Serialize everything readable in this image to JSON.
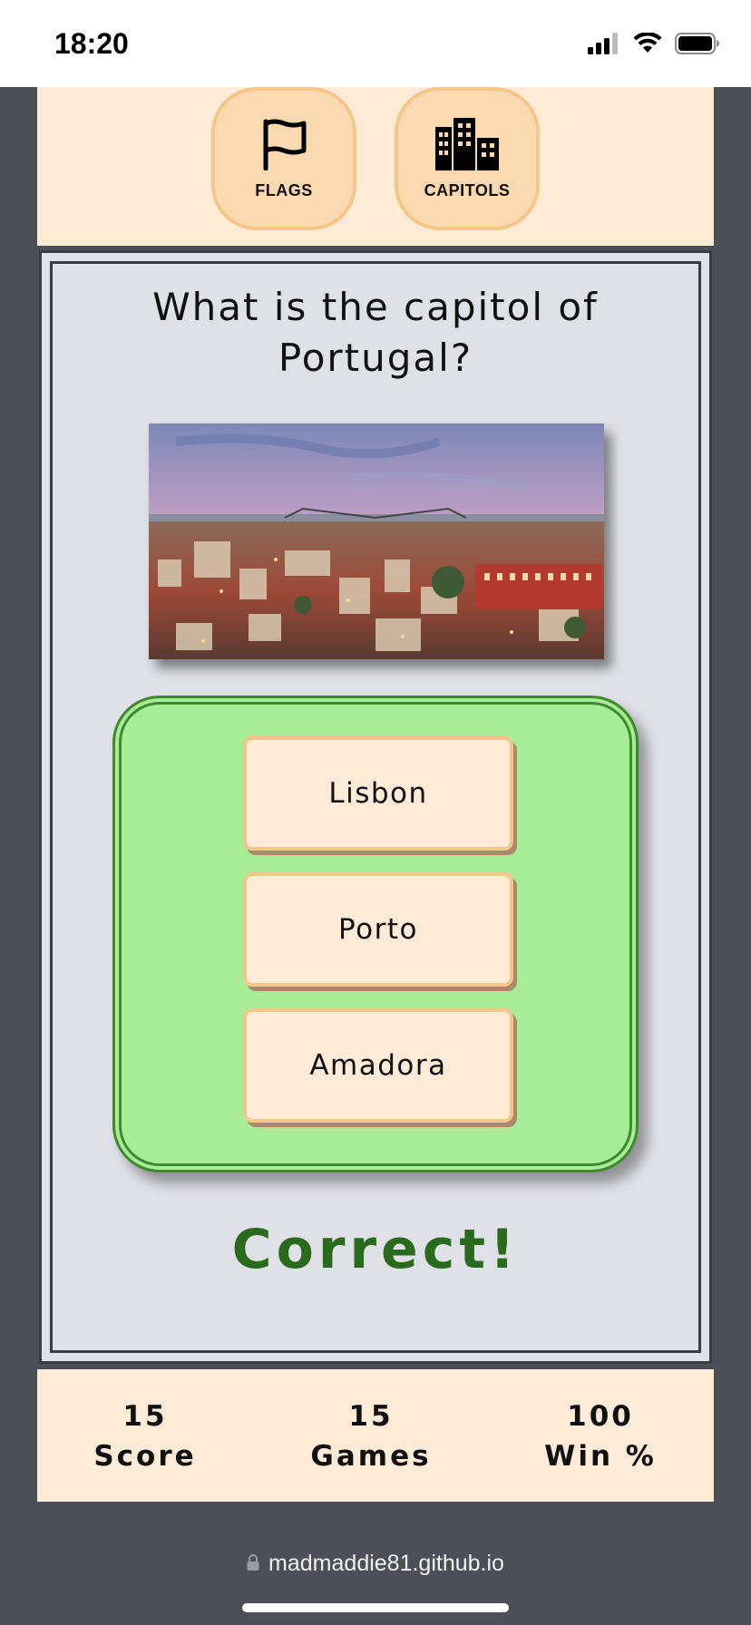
{
  "status_bar": {
    "time": "18:20",
    "icons": [
      "signal-icon",
      "wifi-icon",
      "battery-icon"
    ]
  },
  "nav": {
    "flags_label": "FLAGS",
    "flags_icon": "flag-icon",
    "capitols_label": "CAPITOLS",
    "capitols_icon": "city-icon"
  },
  "game": {
    "question": "What is the capitol of Portugal?",
    "image_subject": "city-skyline-photo",
    "answers": [
      "Lisbon",
      "Porto",
      "Amadora"
    ],
    "result": "Correct!"
  },
  "stats": [
    {
      "value": "15",
      "label": "Score"
    },
    {
      "value": "15",
      "label": "Games"
    },
    {
      "value": "100",
      "label": "Win %"
    }
  ],
  "browser": {
    "url": "madmaddie81.github.io",
    "lock_icon": "lock-icon"
  },
  "colors": {
    "cream": "#fdebd7",
    "peach": "#fbd9b0",
    "panel_green": "#a7ec96",
    "result_green": "#2a6a1c",
    "game_bg": "#e0e1e7",
    "page_bg": "#4c4f58"
  }
}
